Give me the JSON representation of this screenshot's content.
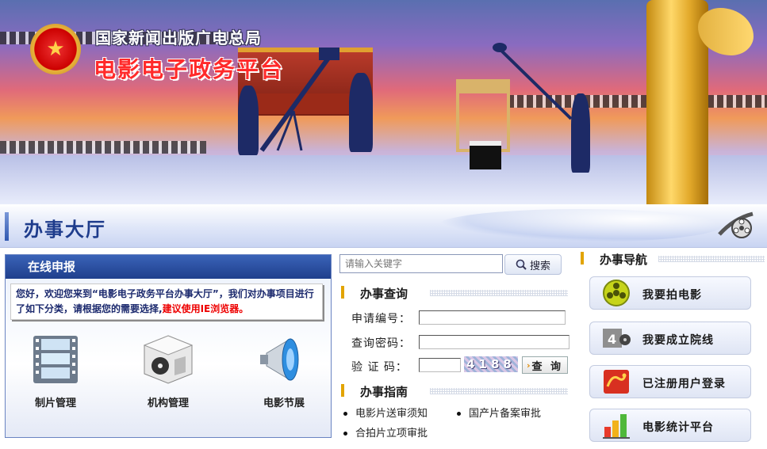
{
  "banner": {
    "org_name": "国家新闻出版广电总局",
    "platform_title": "电影电子政务平台"
  },
  "hall": {
    "title": "办事大厅"
  },
  "online": {
    "title": "在线申报",
    "notice_main": "您好，欢迎您来到“电影电子政务平台办事大厅”，我们对办事项目进行了如下分类，请根据您的需要选择,",
    "notice_highlight": "建议使用IE浏览器。",
    "categories": [
      {
        "label": "制片管理",
        "icon": "film-strip-icon"
      },
      {
        "label": "机构管理",
        "icon": "film-box-icon"
      },
      {
        "label": "电影节展",
        "icon": "megaphone-icon"
      }
    ]
  },
  "search": {
    "placeholder": "请输入关键字",
    "button": "搜索"
  },
  "query": {
    "title": "办事查询",
    "app_no_label": "申请编号：",
    "password_label": "查询密码：",
    "captcha_label": "验 证 码：",
    "captcha_value": "4188",
    "button": "查 询"
  },
  "guide": {
    "title": "办事指南",
    "items": [
      "电影片送审须知",
      "国产片备案审批",
      "合拍片立项审批"
    ]
  },
  "nav": {
    "title": "办事导航",
    "buttons": [
      {
        "label": "我要拍电影",
        "icon": "film-reel-icon"
      },
      {
        "label": "我要成立院线",
        "icon": "projector-icon"
      },
      {
        "label": "已注册用户登录",
        "icon": "dragon-icon"
      },
      {
        "label": "电影统计平台",
        "icon": "bar-chart-icon"
      }
    ]
  },
  "colors": {
    "accent_blue": "#1f3f8c",
    "title_red": "#ff2a2a",
    "section_bar": "#e2a400"
  }
}
